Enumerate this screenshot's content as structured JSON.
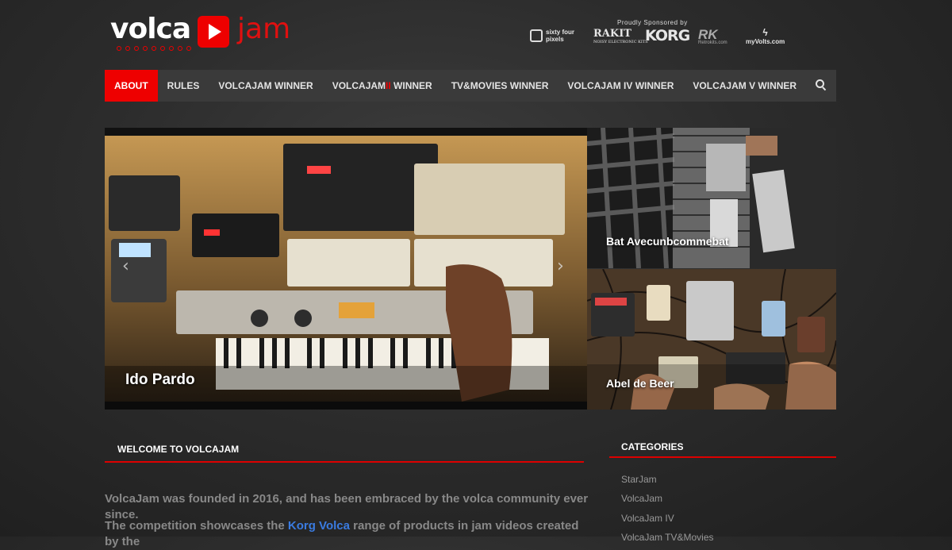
{
  "logo": {
    "word1": "volca",
    "word2": "jam"
  },
  "sponsors": {
    "title": "Proudly Sponsored by",
    "sixty_four_line1": "sixty four",
    "sixty_four_line2": "pixels",
    "rakit": "RAKIT",
    "rakit_sub": "NOISY ELECTRONIC KITS",
    "korg": "KORG",
    "rk": "RK",
    "rk_sub": "Retrokits.com",
    "myvolts": "myVolts.com"
  },
  "nav": {
    "items": [
      "ABOUT",
      "RULES",
      "VOLCAJAM WINNER",
      "VOLCAJAM",
      "II",
      "WINNER",
      "TV&MOVIES WINNER",
      "VOLCAJAM IV WINNER",
      "VOLCAJAM V WINNER"
    ]
  },
  "slider": {
    "main_caption": "Ido Pardo",
    "thumb1_caption": "Bat Avecunbcommebat",
    "thumb2_caption": "Abel de Beer",
    "prev": "‹",
    "next": "›"
  },
  "welcome": {
    "title": "WELCOME TO VOLCAJAM",
    "p1": "VolcaJam was founded in 2016, and has been embraced by the volca community ever since.",
    "p2_before": "The competition showcases the",
    "p2_link": "Korg Volca",
    "p2_after": "range of products in jam videos created by the"
  },
  "categories": {
    "title": "CATEGORIES",
    "items": [
      "StarJam",
      "VolcaJam",
      "VolcaJam IV",
      "VolcaJam TV&Movies"
    ]
  },
  "colors": {
    "accent": "#e00000",
    "nav_bg": "#3a3a3a",
    "link": "#3a7be0"
  }
}
